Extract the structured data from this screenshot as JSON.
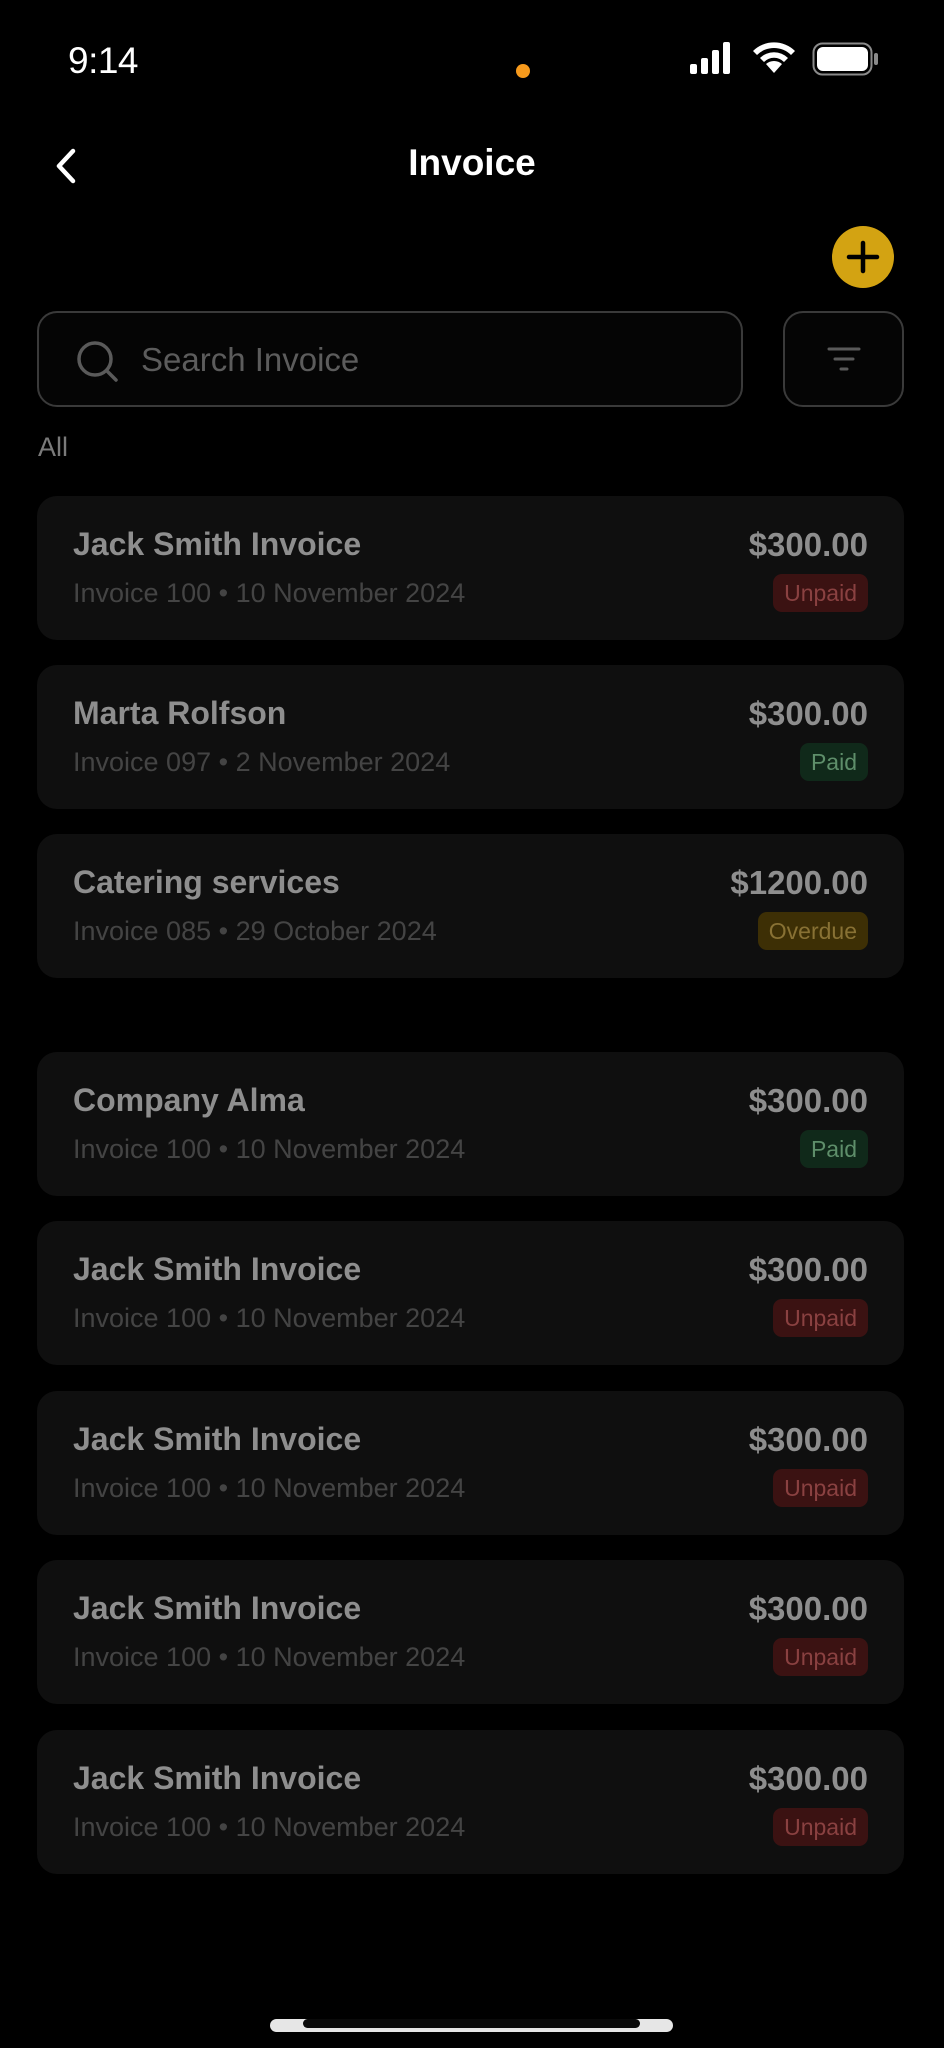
{
  "status": {
    "time": "9:14"
  },
  "header": {
    "title": "Invoice"
  },
  "search": {
    "placeholder": "Search Invoice"
  },
  "section": {
    "all_label": "All"
  },
  "colors": {
    "accent": "#d3a312",
    "unpaid": "#3b1212",
    "paid": "#10291a",
    "overdue": "#3d2f05"
  },
  "invoices": [
    {
      "name": "Jack Smith Invoice",
      "number": "Invoice 100",
      "date": "10 November 2024",
      "amount": "$300.00",
      "status": "Unpaid"
    },
    {
      "name": "Marta Rolfson",
      "number": "Invoice 097",
      "date": "2 November 2024",
      "amount": "$300.00",
      "status": "Paid"
    },
    {
      "name": "Catering services",
      "number": "Invoice 085",
      "date": "29 October 2024",
      "amount": "$1200.00",
      "status": "Overdue"
    },
    {
      "name": "Company Alma",
      "number": "Invoice 100",
      "date": "10 November 2024",
      "amount": "$300.00",
      "status": "Paid"
    },
    {
      "name": "Jack Smith Invoice",
      "number": "Invoice 100",
      "date": "10 November 2024",
      "amount": "$300.00",
      "status": "Unpaid"
    },
    {
      "name": "Jack Smith Invoice",
      "number": "Invoice 100",
      "date": "10 November 2024",
      "amount": "$300.00",
      "status": "Unpaid"
    },
    {
      "name": "Jack Smith Invoice",
      "number": "Invoice 100",
      "date": "10 November 2024",
      "amount": "$300.00",
      "status": "Unpaid"
    },
    {
      "name": "Jack Smith Invoice",
      "number": "Invoice 100",
      "date": "10 November 2024",
      "amount": "$300.00",
      "status": "Unpaid"
    }
  ]
}
